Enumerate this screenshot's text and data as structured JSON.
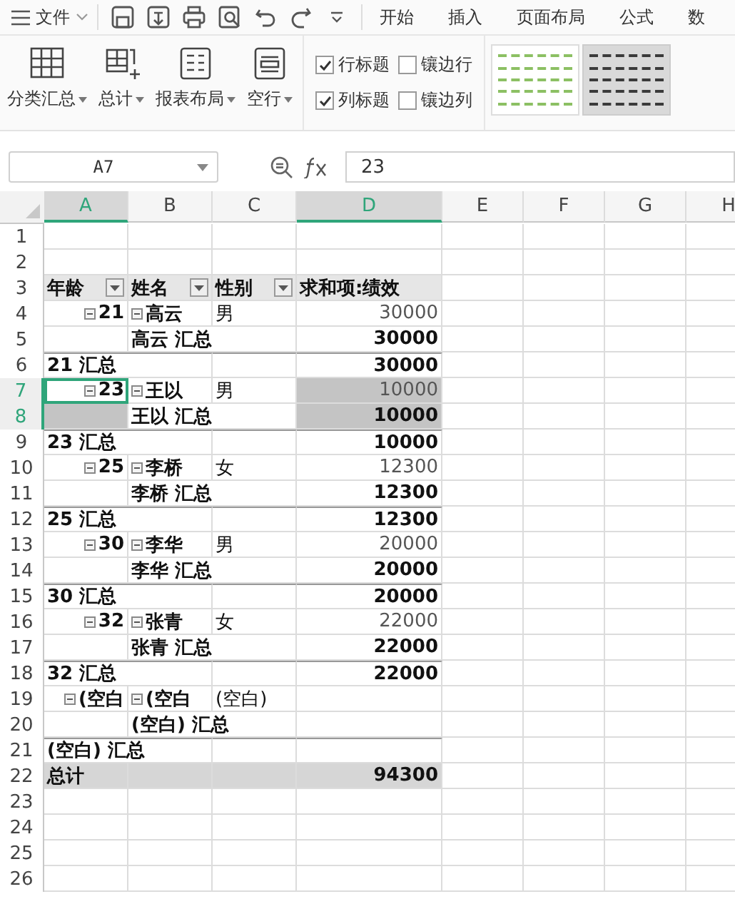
{
  "menu_bar": {
    "file_menu": "文件",
    "quick_tools": [
      {
        "kind": "save"
      },
      {
        "kind": "export"
      },
      {
        "kind": "print"
      },
      {
        "kind": "preview"
      },
      {
        "kind": "undo"
      },
      {
        "kind": "redo"
      },
      {
        "kind": "more"
      }
    ],
    "tabs": [
      {
        "label": "开始",
        "selected": false
      },
      {
        "label": "插入",
        "selected": false
      },
      {
        "label": "页面布局",
        "selected": false
      },
      {
        "label": "公式",
        "selected": false
      },
      {
        "label": "数",
        "selected": false
      }
    ]
  },
  "ribbon": {
    "buttons": [
      {
        "label": "分类汇总",
        "kind": "subtotal"
      },
      {
        "label": "总计",
        "kind": "total"
      },
      {
        "label": "报表布局",
        "kind": "layout"
      },
      {
        "label": "空行",
        "kind": "blank"
      }
    ],
    "options": [
      {
        "label": "行标题",
        "checked": true
      },
      {
        "label": "镶边行",
        "checked": false
      },
      {
        "label": "列标题",
        "checked": true
      },
      {
        "label": "镶边列",
        "checked": false
      }
    ],
    "styles": [
      {
        "color": "#8cc063",
        "selected": false
      },
      {
        "color": "#3a3a3a",
        "selected": true
      }
    ]
  },
  "formula_bar": {
    "cell_name": "A7",
    "value": "23"
  },
  "columns": [
    {
      "label": "A",
      "selected": true
    },
    {
      "label": "B",
      "selected": false
    },
    {
      "label": "C",
      "selected": false
    },
    {
      "label": "D",
      "selected": true
    },
    {
      "label": "E",
      "selected": false
    },
    {
      "label": "F",
      "selected": false
    },
    {
      "label": "G",
      "selected": false
    },
    {
      "label": "H",
      "selected": false
    }
  ],
  "rows": [
    {
      "num": "1",
      "selected": false,
      "kind": "empty"
    },
    {
      "num": "2",
      "selected": false,
      "kind": "empty"
    },
    {
      "num": "3",
      "selected": false,
      "kind": "header",
      "cells": [
        {
          "text": "年龄",
          "kind": "filter",
          "selected": false,
          "active": false
        },
        {
          "text": "姓名",
          "kind": "filter",
          "selected": false,
          "active": false
        },
        {
          "text": "性别",
          "kind": "filter",
          "selected": false,
          "active": false
        },
        {
          "text": "求和项:绩效",
          "kind": "plain",
          "selected": false,
          "active": false
        }
      ]
    },
    {
      "num": "4",
      "selected": false,
      "kind": "item",
      "cells": [
        {
          "text": "21",
          "kind": "toggle",
          "expanded": true,
          "selected": false,
          "active": false
        },
        {
          "text": "高云",
          "kind": "toggle",
          "expanded": true,
          "selected": false,
          "active": false
        },
        {
          "text": "男",
          "kind": "plain",
          "selected": false,
          "active": false
        },
        {
          "text": "30000",
          "kind": "plain",
          "selected": false,
          "active": false
        }
      ]
    },
    {
      "num": "5",
      "selected": false,
      "kind": "name_total",
      "cells": [
        {
          "kind": "plain",
          "selected": false,
          "active": false
        },
        {
          "text": "高云 汇总",
          "kind": "plain",
          "selected": false,
          "active": false
        },
        {
          "text": "30000",
          "kind": "plain",
          "selected": false,
          "active": false
        }
      ]
    },
    {
      "num": "6",
      "selected": false,
      "kind": "age_total",
      "cells": [
        {
          "text": "21 汇总",
          "kind": "plain",
          "selected": false,
          "active": false
        },
        {
          "kind": "plain",
          "selected": false,
          "active": false
        },
        {
          "text": "30000",
          "kind": "plain",
          "selected": false,
          "active": false
        }
      ]
    },
    {
      "num": "7",
      "selected": true,
      "kind": "item",
      "cells": [
        {
          "text": "23",
          "kind": "toggle",
          "expanded": true,
          "selected": false,
          "active": true
        },
        {
          "text": "王以",
          "kind": "toggle",
          "expanded": true,
          "selected": false,
          "active": false
        },
        {
          "text": "男",
          "kind": "plain",
          "selected": false,
          "active": false
        },
        {
          "text": "10000",
          "kind": "plain",
          "selected": true,
          "active": false
        }
      ]
    },
    {
      "num": "8",
      "selected": true,
      "kind": "name_total",
      "cells": [
        {
          "kind": "plain",
          "selected": true,
          "active": false
        },
        {
          "text": "王以 汇总",
          "kind": "plain",
          "selected": false,
          "active": false
        },
        {
          "text": "10000",
          "kind": "plain",
          "selected": true,
          "active": false
        }
      ]
    },
    {
      "num": "9",
      "selected": false,
      "kind": "age_total",
      "cells": [
        {
          "text": "23 汇总",
          "kind": "plain",
          "selected": false,
          "active": false
        },
        {
          "kind": "plain",
          "selected": false,
          "active": false
        },
        {
          "text": "10000",
          "kind": "plain",
          "selected": false,
          "active": false
        }
      ]
    },
    {
      "num": "10",
      "selected": false,
      "kind": "item",
      "cells": [
        {
          "text": "25",
          "kind": "toggle",
          "expanded": true,
          "selected": false,
          "active": false
        },
        {
          "text": "李桥",
          "kind": "toggle",
          "expanded": true,
          "selected": false,
          "active": false
        },
        {
          "text": "女",
          "kind": "plain",
          "selected": false,
          "active": false
        },
        {
          "text": "12300",
          "kind": "plain",
          "selected": false,
          "active": false
        }
      ]
    },
    {
      "num": "11",
      "selected": false,
      "kind": "name_total",
      "cells": [
        {
          "kind": "plain",
          "selected": false,
          "active": false
        },
        {
          "text": "李桥 汇总",
          "kind": "plain",
          "selected": false,
          "active": false
        },
        {
          "text": "12300",
          "kind": "plain",
          "selected": false,
          "active": false
        }
      ]
    },
    {
      "num": "12",
      "selected": false,
      "kind": "age_total",
      "cells": [
        {
          "text": "25 汇总",
          "kind": "plain",
          "selected": false,
          "active": false
        },
        {
          "kind": "plain",
          "selected": false,
          "active": false
        },
        {
          "text": "12300",
          "kind": "plain",
          "selected": false,
          "active": false
        }
      ]
    },
    {
      "num": "13",
      "selected": false,
      "kind": "item",
      "cells": [
        {
          "text": "30",
          "kind": "toggle",
          "expanded": true,
          "selected": false,
          "active": false
        },
        {
          "text": "李华",
          "kind": "toggle",
          "expanded": true,
          "selected": false,
          "active": false
        },
        {
          "text": "男",
          "kind": "plain",
          "selected": false,
          "active": false
        },
        {
          "text": "20000",
          "kind": "plain",
          "selected": false,
          "active": false
        }
      ]
    },
    {
      "num": "14",
      "selected": false,
      "kind": "name_total",
      "cells": [
        {
          "kind": "plain",
          "selected": false,
          "active": false
        },
        {
          "text": "李华 汇总",
          "kind": "plain",
          "selected": false,
          "active": false
        },
        {
          "text": "20000",
          "kind": "plain",
          "selected": false,
          "active": false
        }
      ]
    },
    {
      "num": "15",
      "selected": false,
      "kind": "age_total",
      "cells": [
        {
          "text": "30 汇总",
          "kind": "plain",
          "selected": false,
          "active": false
        },
        {
          "kind": "plain",
          "selected": false,
          "active": false
        },
        {
          "text": "20000",
          "kind": "plain",
          "selected": false,
          "active": false
        }
      ]
    },
    {
      "num": "16",
      "selected": false,
      "kind": "item",
      "cells": [
        {
          "text": "32",
          "kind": "toggle",
          "expanded": true,
          "selected": false,
          "active": false
        },
        {
          "text": "张青",
          "kind": "toggle",
          "expanded": true,
          "selected": false,
          "active": false
        },
        {
          "text": "女",
          "kind": "plain",
          "selected": false,
          "active": false
        },
        {
          "text": "22000",
          "kind": "plain",
          "selected": false,
          "active": false
        }
      ]
    },
    {
      "num": "17",
      "selected": false,
      "kind": "name_total",
      "cells": [
        {
          "kind": "plain",
          "selected": false,
          "active": false
        },
        {
          "text": "张青 汇总",
          "kind": "plain",
          "selected": false,
          "active": false
        },
        {
          "text": "22000",
          "kind": "plain",
          "selected": false,
          "active": false
        }
      ]
    },
    {
      "num": "18",
      "selected": false,
      "kind": "age_total",
      "cells": [
        {
          "text": "32 汇总",
          "kind": "plain",
          "selected": false,
          "active": false
        },
        {
          "kind": "plain",
          "selected": false,
          "active": false
        },
        {
          "text": "22000",
          "kind": "plain",
          "selected": false,
          "active": false
        }
      ]
    },
    {
      "num": "19",
      "selected": false,
      "kind": "item",
      "cells": [
        {
          "text": "(空白",
          "kind": "toggle",
          "expanded": true,
          "selected": false,
          "active": false
        },
        {
          "text": "(空白",
          "kind": "toggle",
          "expanded": true,
          "selected": false,
          "active": false
        },
        {
          "text": "(空白)",
          "kind": "plain",
          "selected": false,
          "active": false
        },
        {
          "kind": "plain",
          "selected": false,
          "active": false
        }
      ]
    },
    {
      "num": "20",
      "selected": false,
      "kind": "name_total",
      "cells": [
        {
          "kind": "plain",
          "selected": false,
          "active": false
        },
        {
          "text": "(空白) 汇总",
          "kind": "plain",
          "selected": false,
          "active": false
        },
        {
          "kind": "plain",
          "selected": false,
          "active": false
        }
      ]
    },
    {
      "num": "21",
      "selected": false,
      "kind": "age_total",
      "cells": [
        {
          "text": "(空白) 汇总",
          "kind": "plain",
          "selected": false,
          "active": false
        },
        {
          "kind": "plain",
          "selected": false,
          "active": false
        },
        {
          "kind": "plain",
          "selected": false,
          "active": false
        }
      ]
    },
    {
      "num": "22",
      "selected": false,
      "kind": "grand_total",
      "cells": [
        {
          "text": "总计",
          "kind": "plain",
          "selected": false,
          "active": false
        },
        {
          "kind": "plain",
          "selected": false,
          "active": false
        },
        {
          "kind": "plain",
          "selected": false,
          "active": false
        },
        {
          "text": "94300",
          "kind": "plain",
          "selected": false,
          "active": false
        }
      ]
    },
    {
      "num": "23",
      "selected": false,
      "kind": "empty"
    },
    {
      "num": "24",
      "selected": false,
      "kind": "empty"
    },
    {
      "num": "25",
      "selected": false,
      "kind": "empty"
    },
    {
      "num": "26",
      "selected": false,
      "kind": "empty"
    }
  ]
}
